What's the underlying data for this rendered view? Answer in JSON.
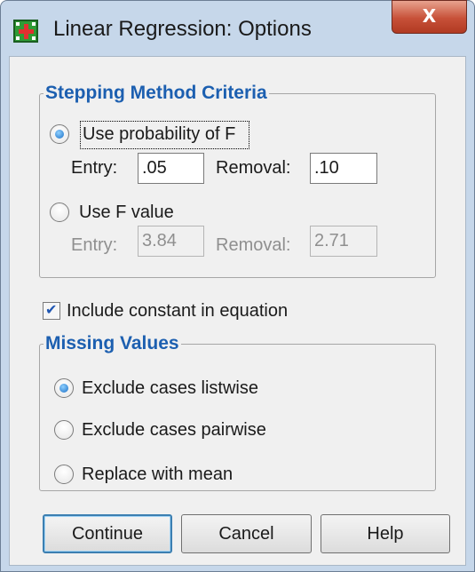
{
  "window": {
    "title": "Linear Regression: Options",
    "close_label": "X"
  },
  "stepping": {
    "legend": "Stepping Method Criteria",
    "use_probability_label": "Use probability of F",
    "use_probability_selected": true,
    "prob_entry_label": "Entry:",
    "prob_entry_value": ".05",
    "prob_removal_label": "Removal:",
    "prob_removal_value": ".10",
    "use_f_value_label": "Use F value",
    "use_f_value_selected": false,
    "f_entry_label": "Entry:",
    "f_entry_value": "3.84",
    "f_removal_label": "Removal:",
    "f_removal_value": "2.71"
  },
  "include_constant": {
    "label": "Include constant in equation",
    "checked": true
  },
  "missing": {
    "legend": "Missing Values",
    "options": [
      {
        "label": "Exclude cases listwise",
        "selected": true
      },
      {
        "label": "Exclude cases pairwise",
        "selected": false
      },
      {
        "label": "Replace with mean",
        "selected": false
      }
    ]
  },
  "buttons": {
    "continue_label": "Continue",
    "cancel_label": "Cancel",
    "help_label": "Help"
  },
  "colors": {
    "legend_text": "#1c5fb0",
    "close_button": "#c75038",
    "frame": "#c6d7ea"
  },
  "icons": {
    "app_icon": "spss-grid-icon",
    "close_icon": "close-icon",
    "check_icon": "checkmark-icon"
  }
}
